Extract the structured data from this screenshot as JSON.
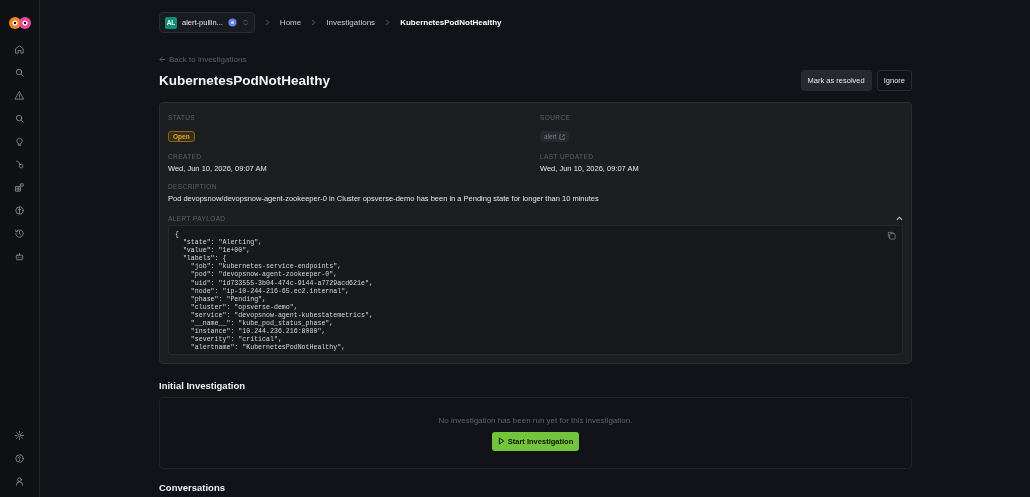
{
  "workspace": {
    "initials": "AL",
    "name": "alert-pullin..."
  },
  "breadcrumbs": [
    {
      "label": "Home",
      "current": false
    },
    {
      "label": "Investigations",
      "current": false
    },
    {
      "label": "KubernetesPodNotHealthy",
      "current": true
    }
  ],
  "back_link": "Back to investigations",
  "title": "KubernetesPodNotHealthy",
  "actions": [
    {
      "label": "Mark as resolved",
      "kind": "secondary"
    },
    {
      "label": "Ignore",
      "kind": "outline"
    }
  ],
  "details": {
    "status_label": "STATUS",
    "status": "Open",
    "source_label": "SOURCE",
    "source": "alert",
    "created_label": "CREATED",
    "created": "Wed, Jun 10, 2026, 09:07 AM",
    "updated_label": "LAST UPDATED",
    "updated": "Wed, Jun 10, 2026, 09:07 AM",
    "description_label": "DESCRIPTION",
    "description": "Pod devopsnow/devopsnow-agent-zookeeper-0 in Cluster opsverse-demo has been in a Pending state for longer than 10 minutes"
  },
  "payload": {
    "label": "ALERT PAYLOAD",
    "expanded": true,
    "lines": [
      "{",
      "  \"state\": \"Alerting\",",
      "  \"value\": \"1e+00\",",
      "  \"labels\": {",
      "    \"job\": \"kubernetes-service-endpoints\",",
      "    \"pod\": \"devopsnow-agent-zookeeper-0\",",
      "    \"uid\": \"1d733555-3b04-474c-9144-a7729acd621e\",",
      "    \"node\": \"ip-10-244-216-65.ec2.internal\",",
      "    \"phase\": \"Pending\",",
      "    \"cluster\": \"opsverse-demo\",",
      "    \"service\": \"devopsnow-agent-kubestatemetrics\",",
      "    \"__name__\": \"kube_pod_status_phase\",",
      "    \"instance\": \"10.244.236.216:8080\",",
      "    \"severity\": \"critical\",",
      "    \"alertname\": \"KubernetesPodNotHealthy\","
    ]
  },
  "initial_investigation": {
    "heading": "Initial Investigation",
    "empty_text": "No investigation has been run yet for this investigation.",
    "button": "Start Investigation"
  },
  "next_heading": "Conversations"
}
